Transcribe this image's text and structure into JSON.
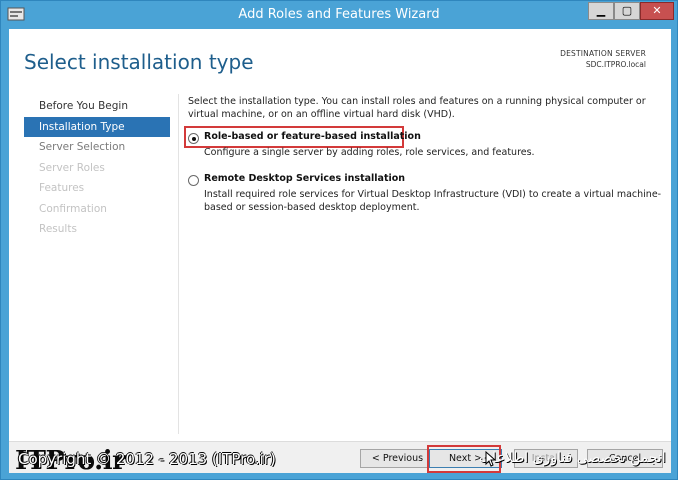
{
  "window": {
    "title": "Add Roles and Features Wizard",
    "min_glyph": "▁",
    "max_glyph": "▢",
    "close_glyph": "✕"
  },
  "header": {
    "page_title": "Select installation type",
    "destination_label": "DESTINATION SERVER",
    "destination_value": "SDC.ITPRO.local"
  },
  "nav": {
    "items": [
      {
        "label": "Before You Begin",
        "state": "enabled"
      },
      {
        "label": "Installation Type",
        "state": "active"
      },
      {
        "label": "Server Selection",
        "state": "enabled-muted"
      },
      {
        "label": "Server Roles",
        "state": "disabled"
      },
      {
        "label": "Features",
        "state": "disabled"
      },
      {
        "label": "Confirmation",
        "state": "disabled"
      },
      {
        "label": "Results",
        "state": "disabled"
      }
    ]
  },
  "content": {
    "intro": "Select the installation type. You can install roles and features on a running physical computer or virtual machine, or on an offline virtual hard disk (VHD).",
    "options": [
      {
        "label": "Role-based or feature-based installation",
        "description": "Configure a single server by adding roles, role services, and features.",
        "selected": true
      },
      {
        "label": "Remote Desktop Services installation",
        "description": "Install required role services for Virtual Desktop Infrastructure (VDI) to create a virtual machine-based or session-based desktop deployment.",
        "selected": false
      }
    ]
  },
  "footer": {
    "logo": "ITPro.ir",
    "copyright": "Copyright © 2012 - 2013 (ITPro.ir)",
    "persian_text": "انجمن تخصصی فناوری اطلاعات",
    "prev_label": "< Previous",
    "next_label": "Next >",
    "install_label": "Install",
    "cancel_label": "Cancel"
  },
  "colors": {
    "accent": "#2a73b4",
    "title_bar": "#4aa3d6",
    "highlight": "#d33a3a"
  }
}
